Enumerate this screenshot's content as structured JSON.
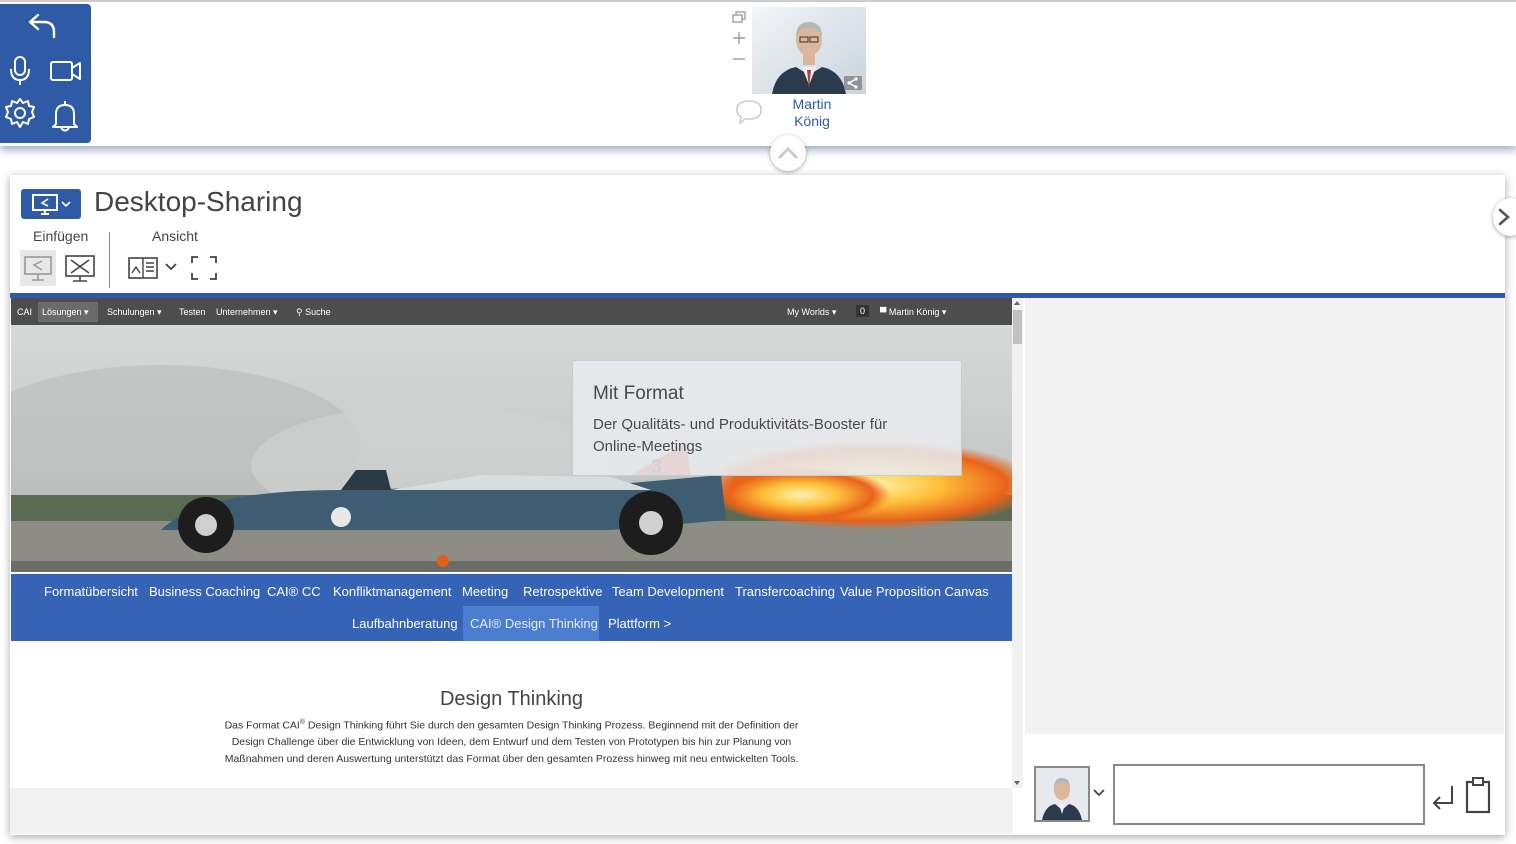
{
  "participant": {
    "first_name": "Martin",
    "last_name": "König"
  },
  "panel": {
    "title": "Desktop-Sharing",
    "group_insert": "Einfügen",
    "group_view": "Ansicht"
  },
  "site_nav": {
    "items": [
      "CAI",
      "Lösungen",
      "Schulungen",
      "Testen",
      "Unternehmen",
      "Suche"
    ],
    "right": {
      "worlds": "My Worlds",
      "count": "0",
      "user": "Martin König"
    }
  },
  "hero": {
    "title": "Mit Format",
    "subtitle": "Der Qualitäts- und Produktivitäts-Booster für Online-Meetings",
    "car_number": "3"
  },
  "format_menu": {
    "row1": [
      "Formatübersicht",
      "Business Coaching",
      "CAI® CC",
      "Konfliktmanagement",
      "Meeting",
      "Retrospektive",
      "Team Development",
      "Transfercoaching",
      "Value Proposition Canvas"
    ],
    "row2": [
      "Laufbahnberatung",
      "CAI® Design Thinking",
      "Plattform >"
    ],
    "active": "CAI® Design Thinking"
  },
  "article": {
    "title": "Design Thinking",
    "body_line1_pre": "Das Format CAI",
    "body_line1_sup": "®",
    "body_line1_post": " Design Thinking führt Sie durch den gesamten Design Thinking Prozess. Beginnend mit der Definition der",
    "body_line2": "Design Challenge über die Entwicklung von Ideen, dem Entwurf und dem Testen von Prototypen bis hin zur Planung von",
    "body_line3": "Maßnahmen und deren Auswertung unterstützt das Format über den gesamten Prozess hinweg mit neu entwickelten Tools."
  },
  "chat": {
    "input_value": ""
  },
  "colors": {
    "accent": "#2f5aa6",
    "menu_blue": "#3563b5",
    "menu_active": "#4c7ed0",
    "site_nav": "#4d4d4d"
  },
  "icons": [
    "undo-icon",
    "microphone-icon",
    "camera-icon",
    "settings-icon",
    "bell-icon",
    "restore-icon",
    "plus-icon",
    "minus-icon",
    "share-badge-icon",
    "chat-bubble-icon",
    "chevron-up-icon",
    "chevron-right-icon",
    "screen-share-icon",
    "chevron-down-icon",
    "share-screen-icon",
    "stop-share-icon",
    "view-layout-icon",
    "fullscreen-icon",
    "search-icon",
    "enter-icon",
    "clipboard-icon"
  ]
}
